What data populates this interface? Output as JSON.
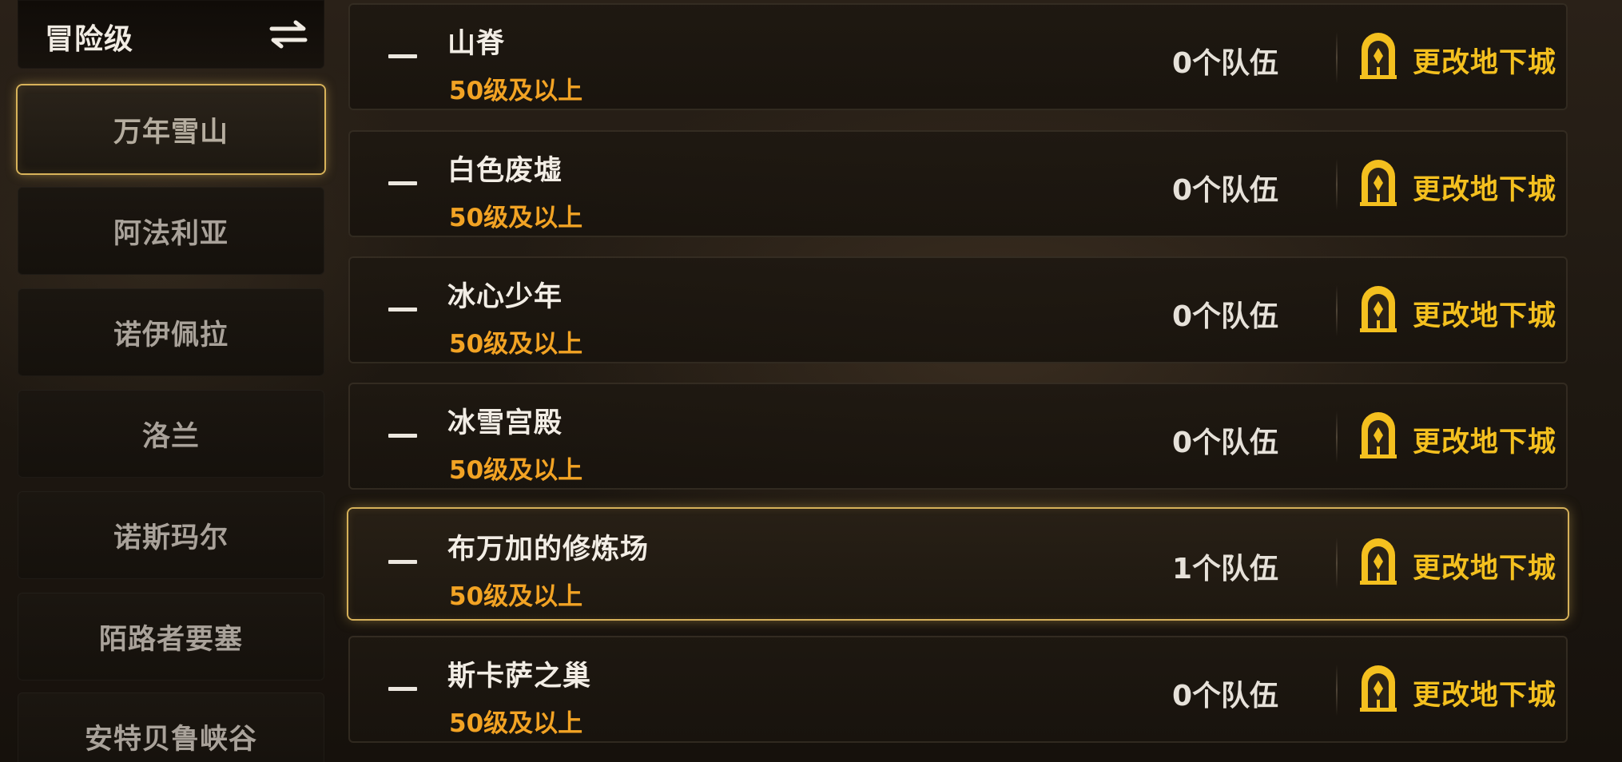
{
  "sidebar": {
    "mode_label": "冒险级",
    "swap_icon": "swap-arrows-icon",
    "categories": [
      {
        "label": "万年雪山",
        "selected": true
      },
      {
        "label": "阿法利亚",
        "selected": false
      },
      {
        "label": "诺伊佩拉",
        "selected": false
      },
      {
        "label": "洛兰",
        "selected": false
      },
      {
        "label": "诺斯玛尔",
        "selected": false
      },
      {
        "label": "陌路者要塞",
        "selected": false
      },
      {
        "label": "安特贝鲁峡谷",
        "selected": false
      }
    ]
  },
  "dungeons": [
    {
      "name": "山脊",
      "level": "50级及以上",
      "teams": "0个队伍",
      "action": "更改地下城",
      "selected": false
    },
    {
      "name": "白色废墟",
      "level": "50级及以上",
      "teams": "0个队伍",
      "action": "更改地下城",
      "selected": false
    },
    {
      "name": "冰心少年",
      "level": "50级及以上",
      "teams": "0个队伍",
      "action": "更改地下城",
      "selected": false
    },
    {
      "name": "冰雪宫殿",
      "level": "50级及以上",
      "teams": "0个队伍",
      "action": "更改地下城",
      "selected": false
    },
    {
      "name": "布万加的修炼场",
      "level": "50级及以上",
      "teams": "1个队伍",
      "action": "更改地下城",
      "selected": true
    },
    {
      "name": "斯卡萨之巢",
      "level": "50级及以上",
      "teams": "0个队伍",
      "action": "更改地下城",
      "selected": false
    }
  ],
  "colors": {
    "accent_gold": "#f4c01f",
    "level_orange": "#f2a324",
    "selection_border": "#d6b15a"
  }
}
